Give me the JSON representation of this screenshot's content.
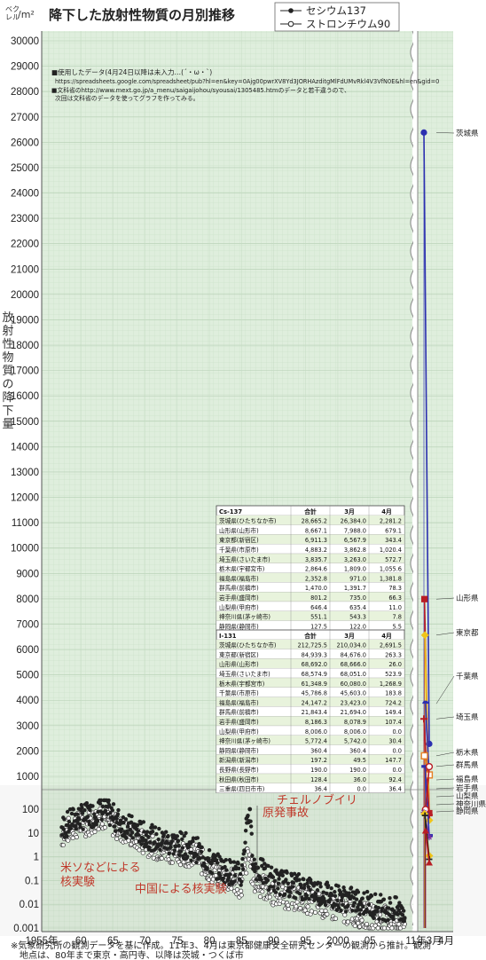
{
  "header": {
    "title": "降下した放射性物質の月別推移",
    "unit_top": "ベク\nレル",
    "unit": "/m²"
  },
  "legend": [
    {
      "label": "セシウム137",
      "marker": "filled",
      "color": "#222222"
    },
    {
      "label": "ストロンチウム90",
      "marker": "open",
      "color": "#222222"
    }
  ],
  "notes": [
    "■使用したデータ(4月24日以降は未入力…(´・ω・`)",
    "https://spreadsheets.google.com/spreadsheet/pub?hl=en&key=0Ajg00pwrXV8Yd3JORHAzditgMlFdUMvRkl4V3VfN0E&hl=en&gid=0",
    "■文科省のhttp://www.mext.go.jp/a_menu/saigaijohou/syousai/1305485.htmのデータと若干違うので、",
    "次回は文科省のデータを使ってグラフを作ってみる。"
  ],
  "ylabel": "放射性物質の降下量",
  "annotations": {
    "chernobyl_1": "チェルノブイリ",
    "chernobyl_2": "原発事故",
    "us_soviet_1": "米ソなどによる",
    "us_soviet_2": "核実験",
    "china": "中国による核実験"
  },
  "footnote": [
    "※気象研究所の観測データを基に作成。11年3、4月は東京都健康安全研究センターの観測から推計。観測",
    "　地点は、80年まで東京・高円寺、以降は茨城・つくば市"
  ],
  "tables": {
    "cs137": {
      "title": "Cs-137",
      "headers": [
        "",
        "合計",
        "3月",
        "4月"
      ],
      "rows": [
        [
          "茨城県(ひたちなか市)",
          "28,665.2",
          "26,384.0",
          "2,281.2"
        ],
        [
          "山形県(山形市)",
          "8,667.1",
          "7,988.0",
          "679.1"
        ],
        [
          "東京都(新宿区)",
          "6,911.3",
          "6,567.9",
          "343.4"
        ],
        [
          "千葉県(市原市)",
          "4,883.2",
          "3,862.8",
          "1,020.4"
        ],
        [
          "埼玉県(さいたま市)",
          "3,835.7",
          "3,263.0",
          "572.7"
        ],
        [
          "栃木県(宇都宮市)",
          "2,864.6",
          "1,809.0",
          "1,055.6"
        ],
        [
          "福島県(福島市)",
          "2,352.8",
          "971.0",
          "1,381.8"
        ],
        [
          "群馬県(前橋市)",
          "1,470.0",
          "1,391.7",
          "78.3"
        ],
        [
          "岩手県(盛岡市)",
          "801.2",
          "735.0",
          "66.3"
        ],
        [
          "山梨県(甲府市)",
          "646.4",
          "635.4",
          "11.0"
        ],
        [
          "神奈川県(茅ヶ崎市)",
          "551.1",
          "543.3",
          "7.8"
        ],
        [
          "静岡県(静岡市)",
          "127.5",
          "122.0",
          "5.5"
        ]
      ]
    },
    "i131": {
      "title": "I-131",
      "headers": [
        "",
        "合計",
        "3月",
        "4月"
      ],
      "rows": [
        [
          "茨城県(ひたちなか市)",
          "212,725.5",
          "210,034.0",
          "2,691.5"
        ],
        [
          "東京都(新宿区)",
          "84,939.3",
          "84,676.0",
          "263.3"
        ],
        [
          "山形県(山形市)",
          "68,692.0",
          "68,666.0",
          "26.0"
        ],
        [
          "埼玉県(さいたま市)",
          "68,574.9",
          "68,051.0",
          "523.9"
        ],
        [
          "栃木県(宇都宮市)",
          "61,348.9",
          "60,080.0",
          "1,268.9"
        ],
        [
          "千葉県(市原市)",
          "45,786.8",
          "45,603.0",
          "183.8"
        ],
        [
          "福島県(福島市)",
          "24,147.2",
          "23,423.0",
          "724.2"
        ],
        [
          "群馬県(前橋市)",
          "21,843.4",
          "21,694.0",
          "149.4"
        ],
        [
          "岩手県(盛岡市)",
          "8,186.3",
          "8,078.9",
          "107.4"
        ],
        [
          "山梨県(甲府市)",
          "8,006.0",
          "8,006.0",
          "0.0"
        ],
        [
          "神奈川県(茅ヶ崎市)",
          "5,772.4",
          "5,742.0",
          "30.4"
        ],
        [
          "静岡県(静岡市)",
          "360.4",
          "360.4",
          "0.0"
        ],
        [
          "新潟県(新潟市)",
          "197.2",
          "49.5",
          "147.7"
        ],
        [
          "長野県(長野市)",
          "190.0",
          "190.0",
          "0.0"
        ],
        [
          "秋田県(秋田市)",
          "128.4",
          "36.0",
          "92.4"
        ],
        [
          "三重県(四日市市)",
          "36.4",
          "0.0",
          "36.4"
        ]
      ]
    }
  },
  "chart_data": {
    "type": "scatter",
    "title": "降下した放射性物質の月別推移",
    "ylabel": "放射性物質の降下量",
    "y_upper_axis": {
      "scale": "linear",
      "range": [
        1000,
        30000
      ],
      "ticks": [
        1000,
        2000,
        3000,
        4000,
        5000,
        6000,
        7000,
        8000,
        9000,
        10000,
        11000,
        12000,
        13000,
        14000,
        15000,
        16000,
        17000,
        18000,
        19000,
        20000,
        21000,
        22000,
        23000,
        24000,
        25000,
        26000,
        27000,
        28000,
        29000,
        30000
      ]
    },
    "y_lower_axis": {
      "scale": "log",
      "range": [
        0.001,
        100
      ],
      "ticks": [
        0.001,
        0.01,
        0.1,
        1,
        10,
        100
      ]
    },
    "x_axis": {
      "range": [
        1955,
        2011
      ],
      "tick_labels": [
        "1955年",
        "60",
        "65",
        "70",
        "75",
        "80",
        "85",
        "90",
        "95",
        "2000",
        "05",
        "11年3月",
        "4月"
      ],
      "tick_values": [
        1955,
        1960,
        1965,
        1970,
        1975,
        1980,
        1985,
        1990,
        1995,
        2000,
        2005
      ]
    },
    "grid": true,
    "legend_position": "top-right",
    "series_historical": [
      {
        "name": "セシウム137",
        "anchor_points": [
          [
            1957,
            15
          ],
          [
            1959,
            40
          ],
          [
            1962,
            60
          ],
          [
            1963,
            120
          ],
          [
            1964,
            80
          ],
          [
            1966,
            30
          ],
          [
            1968,
            15
          ],
          [
            1970,
            8
          ],
          [
            1972,
            5
          ],
          [
            1974,
            4
          ],
          [
            1976,
            3
          ],
          [
            1978,
            2
          ],
          [
            1980,
            0.6
          ],
          [
            1982,
            0.3
          ],
          [
            1984,
            0.2
          ],
          [
            1985,
            0.15
          ],
          [
            1986,
            100
          ],
          [
            1987,
            0.4
          ],
          [
            1990,
            0.1
          ],
          [
            1995,
            0.05
          ],
          [
            2000,
            0.02
          ],
          [
            2005,
            0.01
          ],
          [
            2010,
            0.005
          ]
        ]
      },
      {
        "name": "ストロンチウム90",
        "anchor_points": [
          [
            1957,
            8
          ],
          [
            1959,
            20
          ],
          [
            1962,
            30
          ],
          [
            1963,
            60
          ],
          [
            1964,
            40
          ],
          [
            1966,
            15
          ],
          [
            1968,
            8
          ],
          [
            1970,
            4
          ],
          [
            1972,
            2.5
          ],
          [
            1974,
            2
          ],
          [
            1976,
            1.5
          ],
          [
            1978,
            1
          ],
          [
            1980,
            0.3
          ],
          [
            1982,
            0.15
          ],
          [
            1984,
            0.08
          ],
          [
            1985,
            0.06
          ],
          [
            1986,
            1.2
          ],
          [
            1987,
            0.1
          ],
          [
            1990,
            0.03
          ],
          [
            1995,
            0.015
          ],
          [
            2000,
            0.006
          ],
          [
            2005,
            0.003
          ],
          [
            2010,
            0.002
          ]
        ]
      }
    ],
    "series_2011": [
      {
        "name": "茨城県",
        "color": "#2b2fb0",
        "marker": "circle",
        "march": 26384.0,
        "april": 2281.2
      },
      {
        "name": "山形県",
        "color": "#b81d24",
        "marker": "square",
        "march": 7988.0,
        "april": 679.1
      },
      {
        "name": "東京都",
        "color": "#f0c419",
        "marker": "diamond",
        "march": 6567.9,
        "april": 343.4
      },
      {
        "name": "千葉県",
        "color": "#2b2fb0",
        "marker": "half-circle",
        "march": 3862.8,
        "april": 1020.4
      },
      {
        "name": "埼玉県",
        "color": "#b81d24",
        "marker": "plus",
        "march": 3263.0,
        "april": 572.7
      },
      {
        "name": "栃木県",
        "color": "#e67e22",
        "marker": "square-open",
        "march": 1809.0,
        "april": 1055.6
      },
      {
        "name": "群馬県",
        "color": "#2b2fb0",
        "marker": "bar",
        "march": 1391.7,
        "april": 78.3
      },
      {
        "name": "福島県",
        "color": "#b81d24",
        "marker": "circle-open",
        "march": 971.0,
        "april": 1381.8
      },
      {
        "name": "岩手県",
        "color": "#7a2ea0",
        "marker": "asterisk",
        "march": 735.0,
        "april": 66.3
      },
      {
        "name": "山梨県",
        "color": "#f0c419",
        "marker": "diamond",
        "march": 635.4,
        "april": 11.0
      },
      {
        "name": "神奈川県",
        "color": "#222222",
        "marker": "cross",
        "march": 543.3,
        "april": 7.8
      },
      {
        "name": "静岡県",
        "color": "#b81d24",
        "marker": "triangle",
        "march": 122.0,
        "april": 5.5
      }
    ],
    "right_labels": [
      "茨城県",
      "山形県",
      "東京都",
      "千葉県",
      "埼玉県",
      "栃木県",
      "群馬県",
      "福島県",
      "岩手県",
      "山梨県",
      "神奈川県",
      "静岡県"
    ]
  }
}
